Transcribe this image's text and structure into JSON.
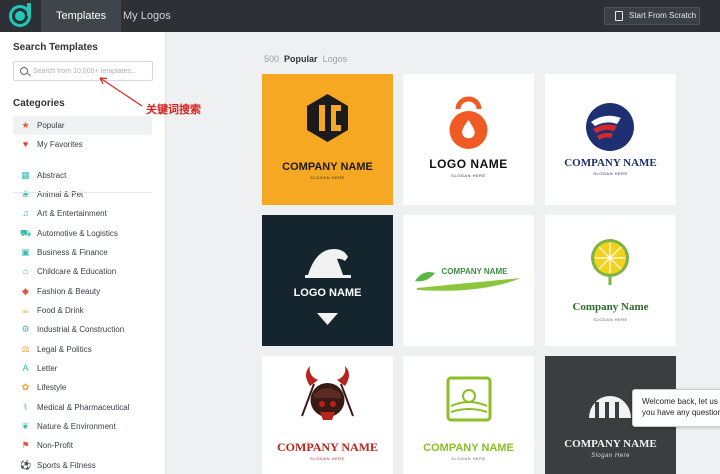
{
  "topbar": {
    "tabs": [
      {
        "label": "Templates"
      },
      {
        "label": "My Logos"
      }
    ],
    "scratch_button": "Start From Scratch"
  },
  "sidebar": {
    "search_title": "Search Templates",
    "search_placeholder": "Search from 10,000+ templates...",
    "categories_title": "Categories",
    "categories": [
      {
        "label": "Popular",
        "icon": "star-badge-icon",
        "color": "#f05a24"
      },
      {
        "label": "My Favorites",
        "icon": "heart-icon",
        "color": "#e8382f"
      },
      {
        "label": "Abstract",
        "icon": "abstract-icon",
        "color": "#3bb9b0"
      },
      {
        "label": "Animal & Pet",
        "icon": "paw-icon",
        "color": "#3bb9b0"
      },
      {
        "label": "Art & Entertainment",
        "icon": "music-note-icon",
        "color": "#3bb9b0"
      },
      {
        "label": "Automotive & Logistics",
        "icon": "car-icon",
        "color": "#3bb9b0"
      },
      {
        "label": "Business & Finance",
        "icon": "briefcase-icon",
        "color": "#3bb9b0"
      },
      {
        "label": "Childcare & Education",
        "icon": "graduation-cap-icon",
        "color": "#3bb9b0"
      },
      {
        "label": "Fashion & Beauty",
        "icon": "diamond-icon",
        "color": "#e8503f"
      },
      {
        "label": "Food & Drink",
        "icon": "food-icon",
        "color": "#f39a2c"
      },
      {
        "label": "Industrial & Construction",
        "icon": "gear-icon",
        "color": "#3bb9b0"
      },
      {
        "label": "Legal & Politics",
        "icon": "scales-icon",
        "color": "#f39a2c"
      },
      {
        "label": "Letter",
        "icon": "letter-a-icon",
        "color": "#3bb9b0"
      },
      {
        "label": "Lifestyle",
        "icon": "lifestyle-icon",
        "color": "#f39a2c"
      },
      {
        "label": "Medical & Pharmaceutical",
        "icon": "stethoscope-icon",
        "color": "#3bb9b0"
      },
      {
        "label": "Nature & Environment",
        "icon": "leaf-icon",
        "color": "#3bb9b0"
      },
      {
        "label": "Non-Profit",
        "icon": "ribbon-icon",
        "color": "#e8503f"
      },
      {
        "label": "Sports & Fitness",
        "icon": "ball-icon",
        "color": "#3bb9b0"
      }
    ]
  },
  "annotation": {
    "text": "关键词搜索",
    "color": "#d8261e"
  },
  "main": {
    "count": "500",
    "heading": "Popular",
    "heading_suffix": "Logos",
    "templates": [
      {
        "title": "COMPANY NAME",
        "subtitle": "SLOGAN HERE",
        "bg": "#f7a823"
      },
      {
        "title": "LOGO NAME",
        "subtitle": "SLOGAN HERE",
        "bg": "#ffffff"
      },
      {
        "title": "COMPANY NAME",
        "subtitle": "SLOGAN HERE",
        "bg": "#ffffff"
      },
      {
        "title": "LOGO NAME",
        "subtitle": "",
        "bg": "#15252e"
      },
      {
        "title": "COMPANY NAME",
        "subtitle": "",
        "bg": "#ffffff"
      },
      {
        "title": "Company Name",
        "subtitle": "SLOGAN HERE",
        "bg": "#ffffff"
      },
      {
        "title": "COMPANY NAME",
        "subtitle": "SLOGAN HERE",
        "bg": "#ffffff"
      },
      {
        "title": "COMPANY NAME",
        "subtitle": "SLOGAN HERE",
        "bg": "#ffffff"
      },
      {
        "title": "COMPANY NAME",
        "subtitle": "Slogan Here",
        "bg": "#3c3d3f"
      }
    ]
  },
  "chat": {
    "line1": "Welcome back, let us k",
    "line2": "you have any question"
  }
}
